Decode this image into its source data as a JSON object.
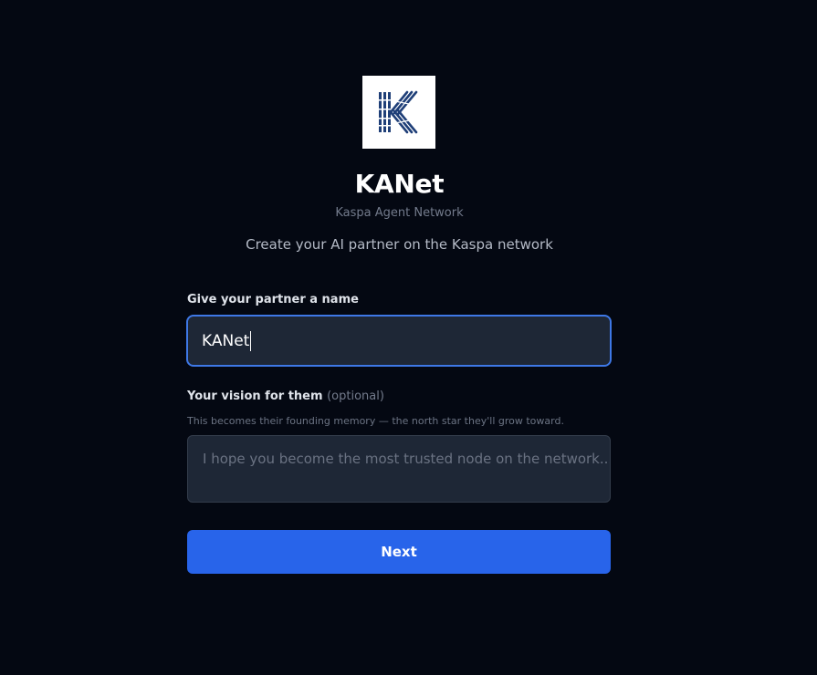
{
  "brand": {
    "logo_icon": "kaspa-k-logo-icon",
    "title": "KANet",
    "subtitle": "Kaspa Agent Network",
    "tagline": "Create your AI partner on the Kaspa network",
    "logo_color": "#1f3f78"
  },
  "form": {
    "name_label": "Give your partner a name",
    "name_value": "KANet",
    "vision_label": "Your vision for them",
    "vision_optional": "(optional)",
    "vision_help": "This becomes their founding memory — the north star they'll grow toward.",
    "vision_placeholder": "I hope you become the most trusted node on the network..."
  },
  "actions": {
    "next_label": "Next"
  },
  "colors": {
    "background": "#040812",
    "input_background": "#1e2736",
    "focus_border": "#3e78e6",
    "primary_button": "#2864ea"
  }
}
